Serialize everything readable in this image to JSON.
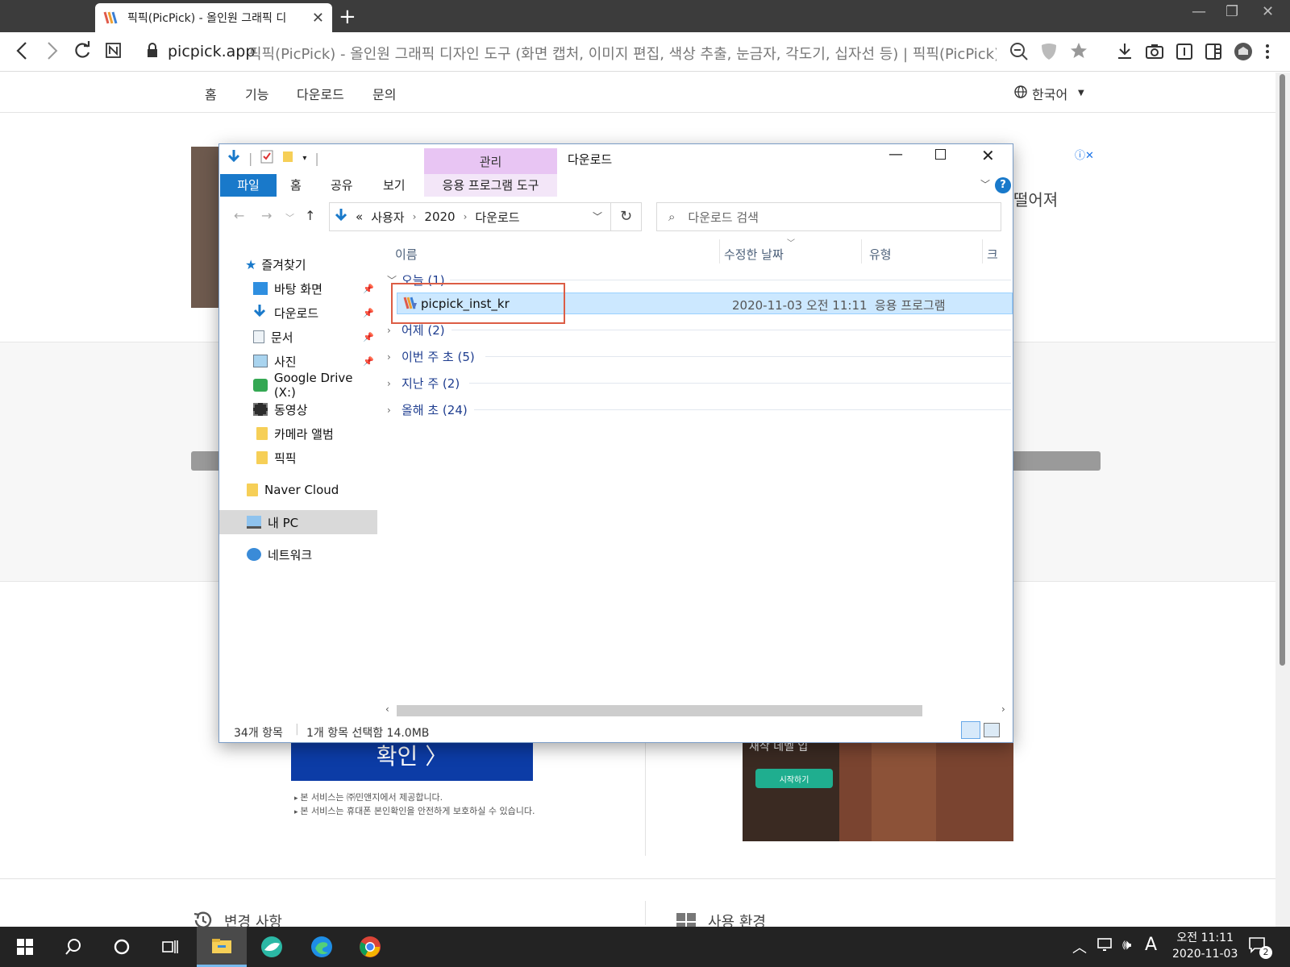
{
  "browser": {
    "tab_title": "픽픽(PicPick) - 올인원 그래픽 디",
    "tab_close": "✕",
    "new_tab": "+",
    "url_domain": "picpick.app",
    "url_title": "픽픽(PicPick) - 올인원 그래픽 디자인 도구 (화면 캡처, 이미지 편집, 색상 추출, 눈금자, 각도기, 십자선 등) | 픽픽(PicPick)",
    "window_controls": {
      "minimize": "—",
      "restore": "❐",
      "close": "✕"
    }
  },
  "site_nav": {
    "items": [
      "홈",
      "기능",
      "다운로드",
      "문의"
    ],
    "language": "한국어"
  },
  "page": {
    "ad_text": "떨어져",
    "confirm_button": "확인 〉",
    "service_notes": [
      "본 서비스는 ㈜민앤지에서 제공합니다.",
      "본 서비스는 휴대폰 본인확인을 안전하게 보호하실 수 있습니다."
    ],
    "ad_right_title": "새삭 데벨 입",
    "ad_right_button": "시작하기",
    "section_changes": "변경 사항",
    "section_env": "사용 환경"
  },
  "explorer": {
    "title": "다운로드",
    "contextual_tab_group": "관리",
    "ribbon_tabs": {
      "file": "파일",
      "home": "홈",
      "share": "공유",
      "view": "보기",
      "app_tools": "응용 프로그램 도구"
    },
    "address": {
      "overflow": "«",
      "path": [
        "사용자",
        "2020",
        "다운로드"
      ]
    },
    "search_placeholder": "다운로드 검색",
    "nav_pane": {
      "quick_access": "즐겨찾기",
      "items": [
        "바탕 화면",
        "다운로드",
        "문서",
        "사진",
        "Google Drive (X:)",
        "동영상",
        "카메라 앨범",
        "픽픽"
      ],
      "naver_cloud": "Naver Cloud",
      "this_pc": "내 PC",
      "network": "네트워크"
    },
    "columns": {
      "name": "이름",
      "modified": "수정한 날짜",
      "type": "유형",
      "size": "크"
    },
    "groups": [
      {
        "label": "오늘 (1)",
        "expanded": true
      },
      {
        "label": "어제 (2)",
        "expanded": false
      },
      {
        "label": "이번 주 초 (5)",
        "expanded": false
      },
      {
        "label": "지난 주 (2)",
        "expanded": false
      },
      {
        "label": "올해 초 (24)",
        "expanded": false
      }
    ],
    "selected_file": {
      "name": "picpick_inst_kr",
      "modified": "2020-11-03 오전 11:11",
      "type": "응용 프로그램"
    },
    "status": {
      "item_count": "34개 항목",
      "selection": "1개 항목 선택함 14.0MB"
    }
  },
  "taskbar": {
    "time": "오전 11:11",
    "date": "2020-11-03",
    "ime": "A",
    "notifications": "2"
  },
  "colors": {
    "accent_blue": "#1979ca",
    "selection_bg": "#cce8ff",
    "highlight_red": "#dc5d45",
    "manage_tab": "#e8c5f3",
    "confirm_button": "#0c3ca6"
  }
}
